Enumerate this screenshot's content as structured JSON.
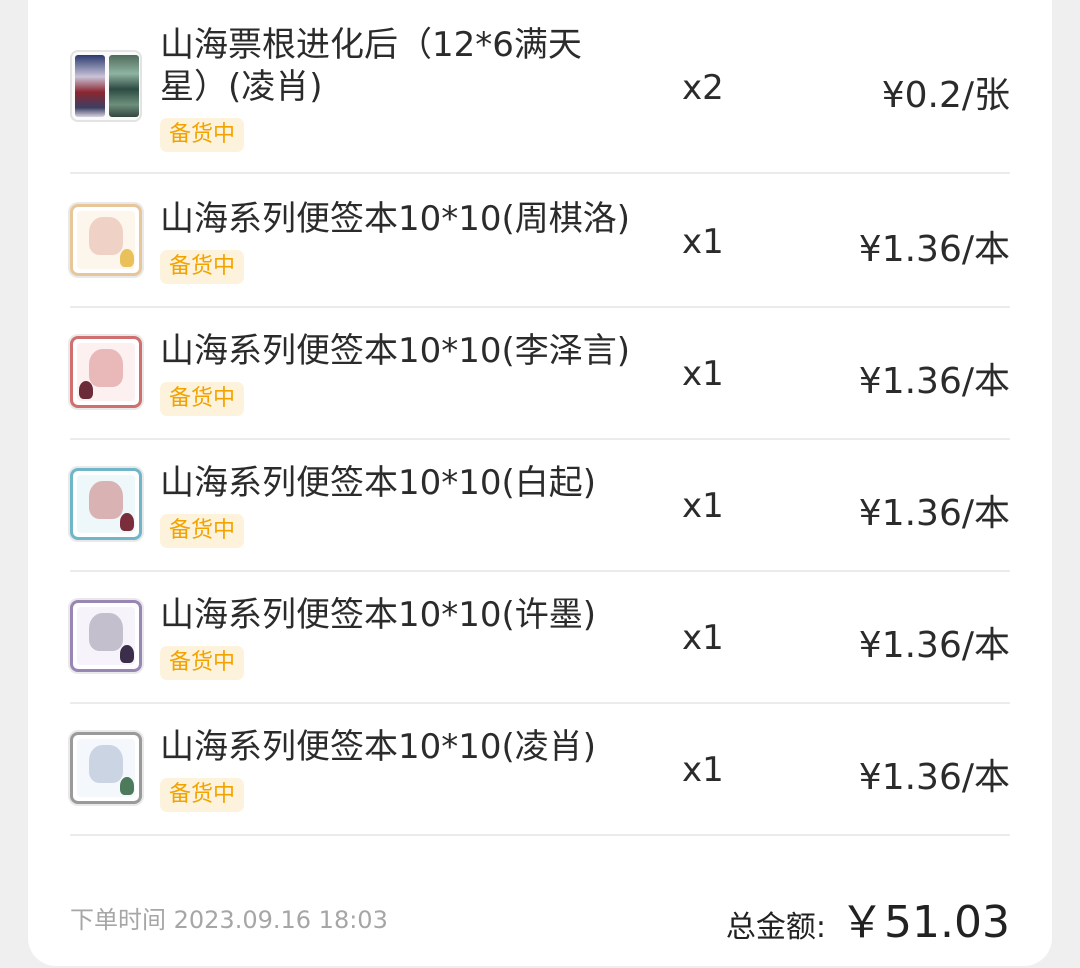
{
  "items": [
    {
      "title": "山海票根进化后（12*6满天星）(凌肖)",
      "status": "备货中",
      "quantity": "x2",
      "price": "¥0.2/张",
      "thumb": "ticket-set-thumbnail"
    },
    {
      "title": "山海系列便签本10*10(周棋洛)",
      "status": "备货中",
      "quantity": "x1",
      "price": "¥1.36/本",
      "thumb_color": "#e7c79a"
    },
    {
      "title": "山海系列便签本10*10(李泽言)",
      "status": "备货中",
      "quantity": "x1",
      "price": "¥1.36/本",
      "thumb_color": "#cf6f6f"
    },
    {
      "title": "山海系列便签本10*10(白起)",
      "status": "备货中",
      "quantity": "x1",
      "price": "¥1.36/本",
      "thumb_color": "#6fb6c9"
    },
    {
      "title": "山海系列便签本10*10(许墨)",
      "status": "备货中",
      "quantity": "x1",
      "price": "¥1.36/本",
      "thumb_color": "#9a86b5"
    },
    {
      "title": "山海系列便签本10*10(凌肖)",
      "status": "备货中",
      "quantity": "x1",
      "price": "¥1.36/本",
      "thumb_color": "#9a9a9a"
    }
  ],
  "footer": {
    "order_time_label": "下单时间 2023.09.16 18:03",
    "total_label": "总金额:",
    "total_amount": "￥51.03"
  },
  "colors": {
    "status_text": "#f2a300",
    "status_bg": "#fdf3dc",
    "text": "#2b2b2b",
    "muted": "#a6a6a6"
  }
}
